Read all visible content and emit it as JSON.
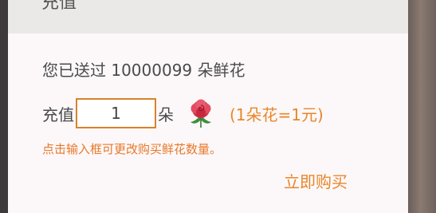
{
  "dialog": {
    "title": "充值",
    "sent_prefix": "您已送过",
    "sent_count": "10000099",
    "sent_suffix": "朵鲜花",
    "recharge_label": "充值",
    "quantity_value": "1",
    "unit_label": "朵",
    "flower_icon": "rose-icon",
    "rate_text": "(1朵花=1元)",
    "hint_text": "点击输入框可更改购买鲜花数量。",
    "buy_button": "立即购买"
  },
  "colors": {
    "accent": "#e8862a",
    "input_border": "#d9822b",
    "header_bg": "#ebe8e8",
    "dialog_bg": "#fcf8f9",
    "text": "#4a4a4a"
  }
}
